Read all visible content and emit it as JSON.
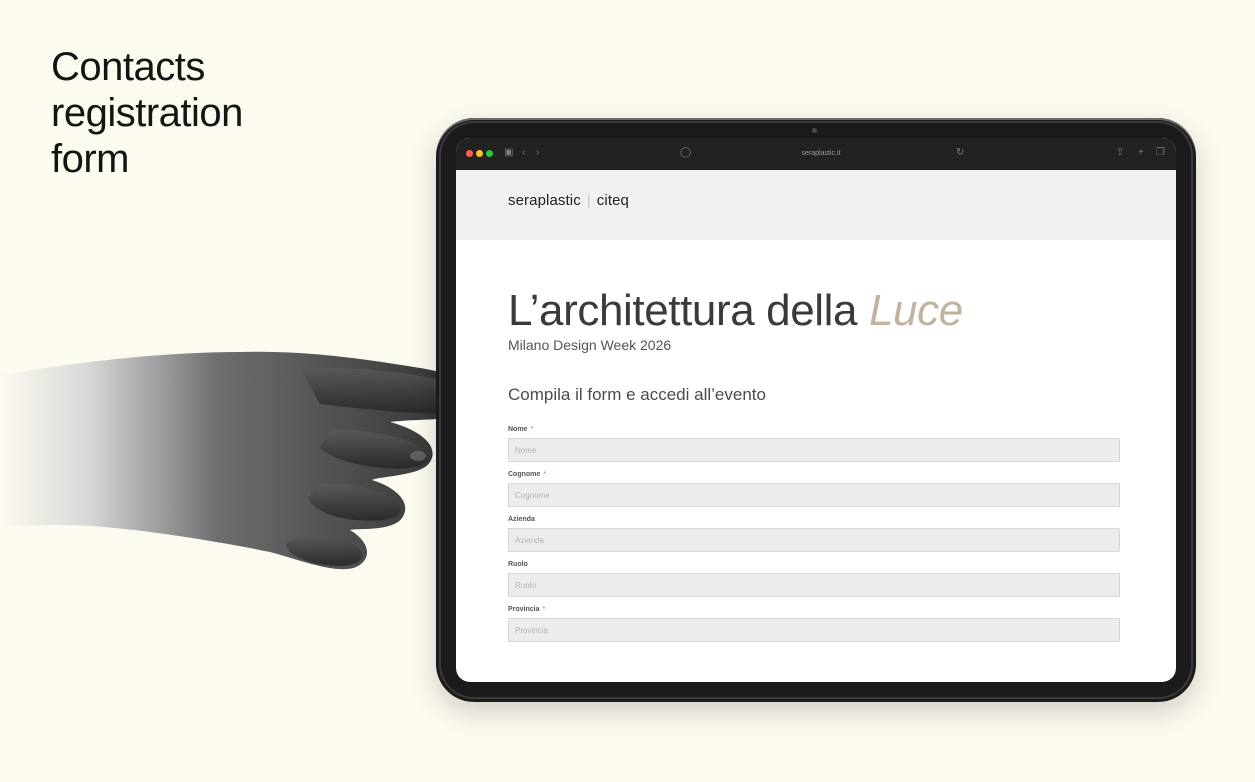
{
  "slide": {
    "title": "Contacts\nregistration\nform"
  },
  "browser": {
    "url": "seraplastic.it",
    "icons": {
      "sidebar": "sidebar-icon",
      "back": "chevron-left-icon",
      "forward": "chevron-right-icon",
      "shield": "shield-icon",
      "reload": "reload-icon",
      "share": "share-icon",
      "new_tab": "plus-icon",
      "tabs": "tabs-icon"
    }
  },
  "site": {
    "brand_primary": "seraplastic",
    "brand_separator": "|",
    "brand_secondary": "citeq"
  },
  "event": {
    "title_main": "L’architettura della ",
    "title_accent": "Luce",
    "subtitle": "Milano Design Week 2026",
    "accent_color": "#c2b3a1"
  },
  "form": {
    "title": "Compila il form e accedi all’evento",
    "fields": [
      {
        "label": "Nome",
        "required_mark": "*",
        "placeholder": "Nome",
        "value": ""
      },
      {
        "label": "Cognome",
        "required_mark": "*",
        "placeholder": "Cognome",
        "value": ""
      },
      {
        "label": "Azienda",
        "required_mark": "",
        "placeholder": "Azienda",
        "value": ""
      },
      {
        "label": "Ruolo",
        "required_mark": "",
        "placeholder": "Ruolo",
        "value": ""
      },
      {
        "label": "Provincia",
        "required_mark": "*",
        "placeholder": "Provincia",
        "value": ""
      }
    ]
  }
}
